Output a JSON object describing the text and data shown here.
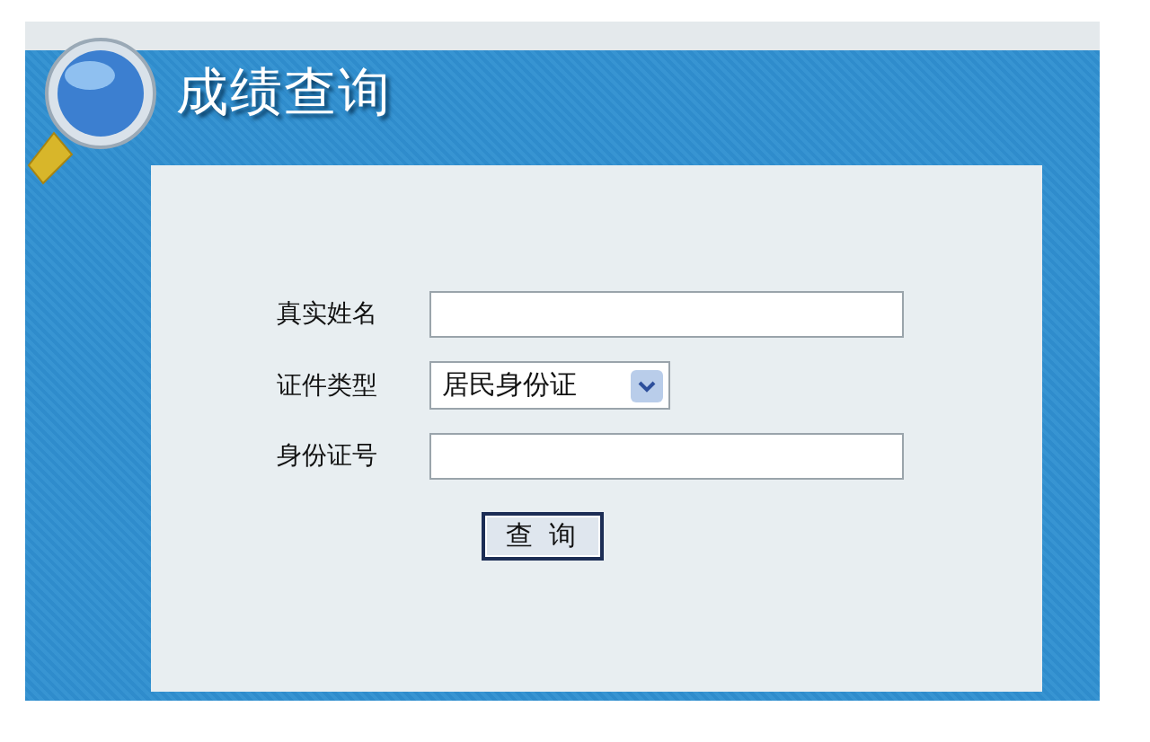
{
  "header": {
    "title": "成绩查询"
  },
  "form": {
    "fields": [
      {
        "kind": "text",
        "label": "真实姓名"
      },
      {
        "kind": "select",
        "label": "证件类型",
        "value": "居民身份证"
      },
      {
        "kind": "text",
        "label": "身份证号"
      }
    ],
    "submit": "查 询"
  }
}
